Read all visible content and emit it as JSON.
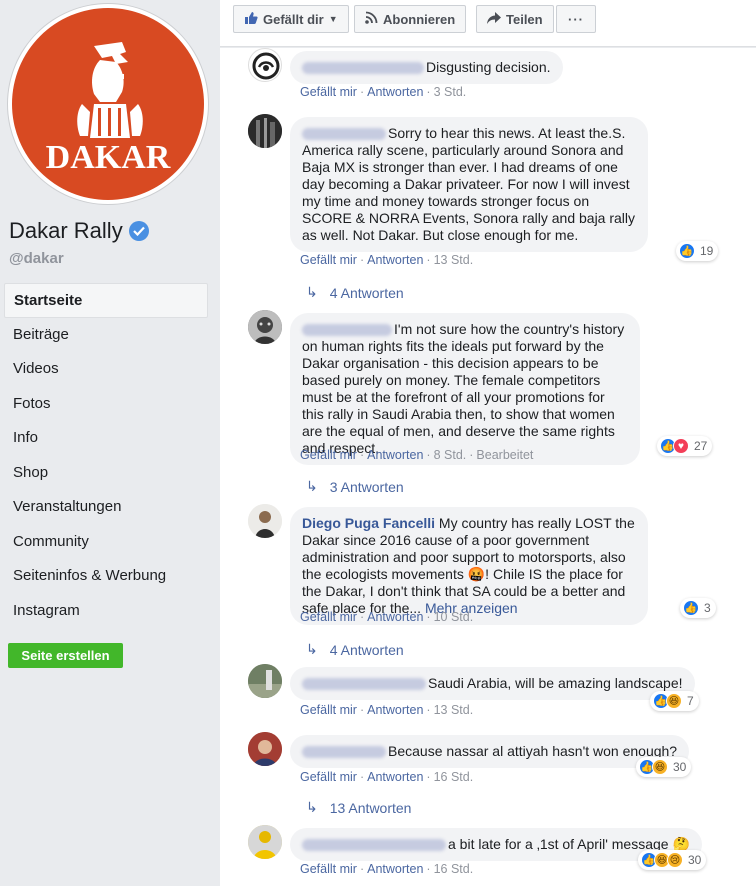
{
  "page": {
    "name": "Dakar Rally",
    "handle": "@dakar",
    "logo_text": "DAKAR"
  },
  "nav": {
    "items": [
      "Startseite",
      "Beiträge",
      "Videos",
      "Fotos",
      "Info",
      "Shop",
      "Veranstaltungen",
      "Community",
      "Seiteninfos & Werbung",
      "Instagram"
    ]
  },
  "create_page_label": "Seite erstellen",
  "topbar": {
    "like_label": "Gefällt dir",
    "subscribe_label": "Abonnieren",
    "share_label": "Teilen",
    "more_label": "···"
  },
  "actions": {
    "like": "Gefällt mir",
    "reply": "Antworten",
    "see_more": "Mehr anzeigen"
  },
  "comments": [
    {
      "author": "",
      "text": "Disgusting decision.",
      "time": "3 Std.",
      "edited": "",
      "reaction_count": "",
      "replies": ""
    },
    {
      "author": "",
      "text": "Sorry to hear this news. At least the.S. America rally scene, particularly around Sonora and Baja MX is stronger than ever. I had dreams of one day becoming a Dakar privateer. For now I will invest my time and money towards stronger focus on SCORE & NORRA Events, Sonora rally and baja rally as well. Not Dakar. But close enough for me.",
      "time": "13 Std.",
      "edited": "",
      "reaction_count": "19",
      "replies": "4 Antworten"
    },
    {
      "author": "",
      "text": "I'm not sure how the country's history on human rights fits the ideals put forward by the Dakar organisation - this decision appears to be based purely on money. The female competitors must be at the forefront of all your promotions for this rally in Saudi Arabia then, to show that women are the equal of men, and deserve the same rights and respect.",
      "time": "8 Std.",
      "edited": "Bearbeitet",
      "reaction_count": "27",
      "replies": "3 Antworten"
    },
    {
      "author": "Diego Puga Fancelli",
      "text": "My country has really LOST the Dakar since 2016 cause of a poor government administration and poor support to motorsports, also the ecologists movements 🤬! Chile IS the place for the Dakar, I don't think that SA could be a better and safe place for the...",
      "time": "10 Std.",
      "edited": "",
      "reaction_count": "3",
      "replies": "4 Antworten"
    },
    {
      "author": "",
      "text": "Saudi Arabia, will be amazing landscape!",
      "time": "13 Std.",
      "edited": "",
      "reaction_count": "7",
      "replies": ""
    },
    {
      "author": "",
      "text": "Because nassar al attiyah hasn't won enough?",
      "time": "16 Std.",
      "edited": "",
      "reaction_count": "30",
      "replies": "13 Antworten"
    },
    {
      "author": "",
      "text": "a bit late for a ‚1st of April' message 🤔",
      "time": "16 Std.",
      "edited": "",
      "reaction_count": "30",
      "replies": ""
    }
  ],
  "colors": {
    "link": "#385898",
    "brand_orange": "#d84a22",
    "green_button": "#42b72a",
    "like_blue": "#1877f2"
  }
}
